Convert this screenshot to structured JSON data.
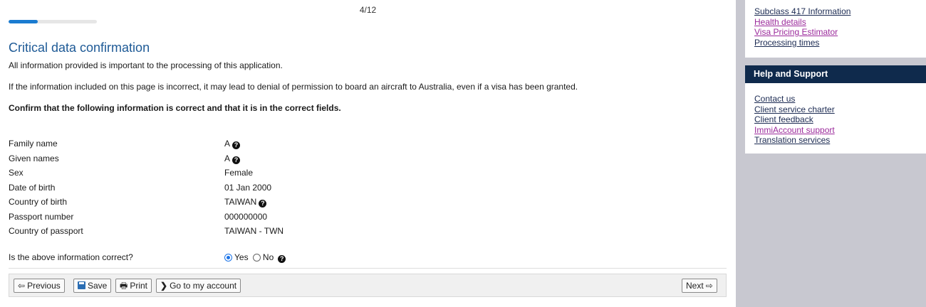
{
  "progress": {
    "label": "4/12",
    "fraction": 0.333
  },
  "page": {
    "title": "Critical data confirmation",
    "intro": "All information provided is important to the processing of this application.",
    "warning": "If the information included on this page is incorrect, it may lead to denial of permission to board an aircraft to Australia, even if a visa has been granted.",
    "instruction": "Confirm that the following information is correct and that it is in the correct fields."
  },
  "fields": [
    {
      "label": "Family name",
      "value": "A",
      "help": true
    },
    {
      "label": "Given names",
      "value": "A",
      "help": true
    },
    {
      "label": "Sex",
      "value": "Female",
      "help": false
    },
    {
      "label": "Date of birth",
      "value": "01 Jan 2000",
      "help": false
    },
    {
      "label": "Country of birth",
      "value": "TAIWAN",
      "help": true
    },
    {
      "label": "Passport number",
      "value": "000000000",
      "help": false
    },
    {
      "label": "Country of passport",
      "value": "TAIWAN - TWN",
      "help": false
    }
  ],
  "question": {
    "label": "Is the above information correct?",
    "options": [
      "Yes",
      "No"
    ],
    "selected": "Yes"
  },
  "buttons": {
    "previous": "Previous",
    "save": "Save",
    "print": "Print",
    "account": "Go to my account",
    "next": "Next"
  },
  "sidebar": {
    "links": [
      {
        "label": "Subclass 417 Information",
        "style": "dark"
      },
      {
        "label": "Health details",
        "style": "purple"
      },
      {
        "label": "Visa Pricing Estimator",
        "style": "purple"
      },
      {
        "label": "Processing times",
        "style": "dark"
      }
    ],
    "help_title": "Help and Support",
    "help_links": [
      {
        "label": "Contact us",
        "style": "dark"
      },
      {
        "label": "Client service charter",
        "style": "dark"
      },
      {
        "label": "Client feedback",
        "style": "dark"
      },
      {
        "label": "ImmiAccount support",
        "style": "purple"
      },
      {
        "label": "Translation services",
        "style": "dark"
      }
    ]
  },
  "colors": {
    "title": "#1e5a96",
    "progress": "#1a7bd0",
    "help_header": "#0f2a4c",
    "link_visited": "#9b2a9b",
    "sidebar_bg": "#c8c8d0"
  },
  "icons": {
    "help": "question-circle-icon",
    "previous": "arrow-left-outline-icon",
    "save": "floppy-disk-icon",
    "print": "printer-icon",
    "account": "chevron-right-icon",
    "next": "arrow-right-outline-icon"
  }
}
